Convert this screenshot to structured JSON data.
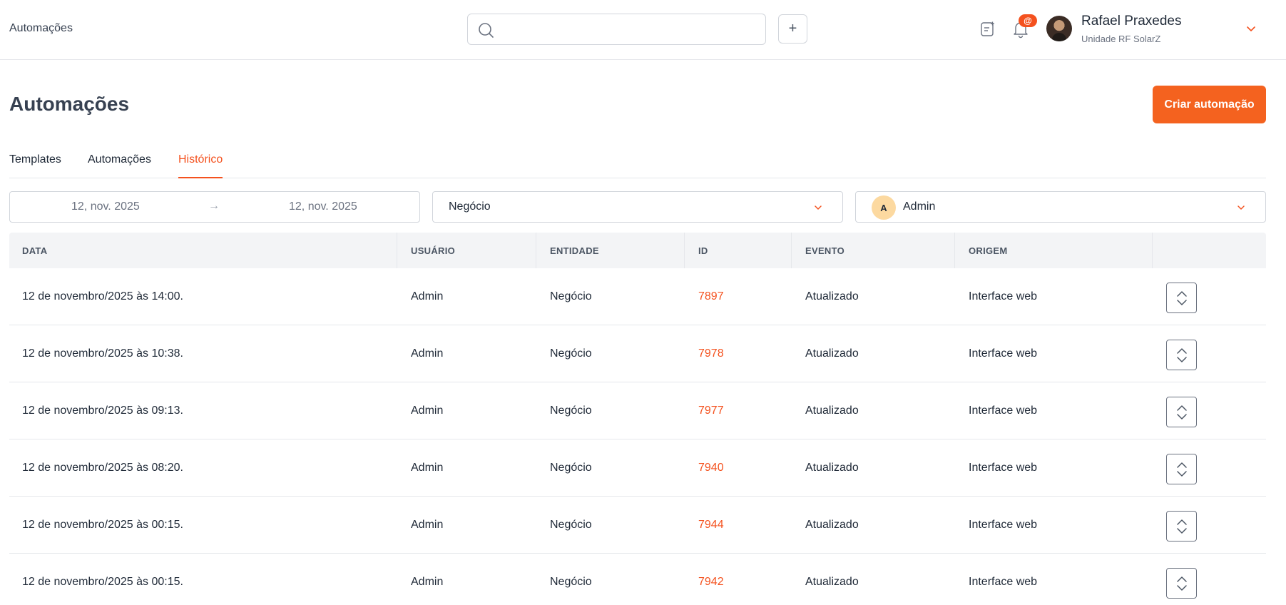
{
  "topbar": {
    "breadcrumb": "Automações",
    "search": {
      "value": "",
      "placeholder": ""
    },
    "add_button_label": "+",
    "notification_badge": "@",
    "user": {
      "name": "Rafael Praxedes",
      "unit": "Unidade RF SolarZ"
    },
    "icons": {
      "search": "search-icon",
      "add": "plus-icon",
      "notes": "notes-icon",
      "notifications": "bell-icon",
      "user_menu": "chevron-down-icon"
    }
  },
  "page": {
    "title": "Automações",
    "create_button_label": "Criar automação",
    "accent_color": "#f4511e"
  },
  "tabs": [
    {
      "label": "Templates",
      "active": false
    },
    {
      "label": "Automações",
      "active": false
    },
    {
      "label": "Histórico",
      "active": true
    }
  ],
  "filters": {
    "date_start": "12, nov. 2025",
    "date_separator": "→",
    "date_end": "12, nov. 2025",
    "entity": "Negócio",
    "user_initial": "A",
    "user": "Admin"
  },
  "table": {
    "headers": {
      "data": "DATA",
      "usuario": "USUÁRIO",
      "entidade": "ENTIDADE",
      "id": "ID",
      "evento": "EVENTO",
      "origem": "ORIGEM"
    },
    "rows": [
      {
        "data": "12 de novembro/2025 às 14:00.",
        "usuario": "Admin",
        "entidade": "Negócio",
        "id": "7897",
        "evento": "Atualizado",
        "origem": "Interface web"
      },
      {
        "data": "12 de novembro/2025 às 10:38.",
        "usuario": "Admin",
        "entidade": "Negócio",
        "id": "7978",
        "evento": "Atualizado",
        "origem": "Interface web"
      },
      {
        "data": "12 de novembro/2025 às 09:13.",
        "usuario": "Admin",
        "entidade": "Negócio",
        "id": "7977",
        "evento": "Atualizado",
        "origem": "Interface web"
      },
      {
        "data": "12 de novembro/2025 às 08:20.",
        "usuario": "Admin",
        "entidade": "Negócio",
        "id": "7940",
        "evento": "Atualizado",
        "origem": "Interface web"
      },
      {
        "data": "12 de novembro/2025 às 00:15.",
        "usuario": "Admin",
        "entidade": "Negócio",
        "id": "7944",
        "evento": "Atualizado",
        "origem": "Interface web"
      },
      {
        "data": "12 de novembro/2025 às 00:15.",
        "usuario": "Admin",
        "entidade": "Negócio",
        "id": "7942",
        "evento": "Atualizado",
        "origem": "Interface web"
      }
    ]
  }
}
